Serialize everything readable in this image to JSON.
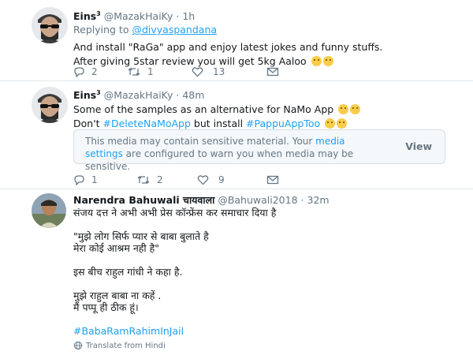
{
  "tweets": [
    {
      "name": "Eins",
      "name_sup": "3",
      "handle": "@MazakHaiKy",
      "sep": "·",
      "time": "1h",
      "replying_prefix": "Replying to ",
      "replying_handle": "@divyaspandana",
      "lines": [
        "And install \"RaGa\" app and enjoy latest jokes and funny stuffs.",
        "After giving 5star review you will get 5kg Aaloo"
      ],
      "emojis": [
        "laughing-crying-emoji",
        "laughing-crying-emoji"
      ],
      "counts": {
        "reply": "2",
        "retweet": "1",
        "like": "13"
      }
    },
    {
      "name": "Eins",
      "name_sup": "3",
      "handle": "@MazakHaiKy",
      "sep": "·",
      "time": "48m",
      "line1": "Some of the samples as an alternative for NaMo App",
      "line2_pre": "Don't ",
      "hashtag1": "#DeleteNaMoApp",
      "line2_mid": " but install ",
      "hashtag2": "#PappuAppToo",
      "emojis_line1": [
        "laughing-crying-emoji",
        "laughing-crying-emoji"
      ],
      "emojis_line2": [
        "grinning-emoji",
        "grinning-emoji"
      ],
      "sensitive": {
        "msg_pre": "This media may contain sensitive material. Your ",
        "msg_link": "media settings",
        "msg_post": " are configured to warn you when media may be sensitive.",
        "view": "View"
      },
      "counts": {
        "reply": "1",
        "retweet": "2",
        "like": "9"
      }
    },
    {
      "name": "Narendra Bahuwali चायवाला",
      "handle": "@Bahuwali2018",
      "sep": "·",
      "time": "32m",
      "lines": [
        "संजय दत्त ने अभी अभी प्रेस कॉन्फ्रेंस कर समाचार दिया है",
        "",
        "\"मुझे लोग सिर्फ प्यार से बाबा बुलाते है",
        "मेरा कोई आश्रम नही है\"",
        "",
        "इस बीच राहुल गांधी ने कहा है.",
        "",
        "मुझे राहुल बाबा ना कहें .",
        "मैं पप्पू ही ठीक हूं।"
      ],
      "hashtag": "#BabaRamRahimInJail",
      "translate": "Translate from Hindi"
    }
  ],
  "colors": {
    "link": "#1da1f2",
    "muted": "#657786",
    "text": "#14171a"
  }
}
